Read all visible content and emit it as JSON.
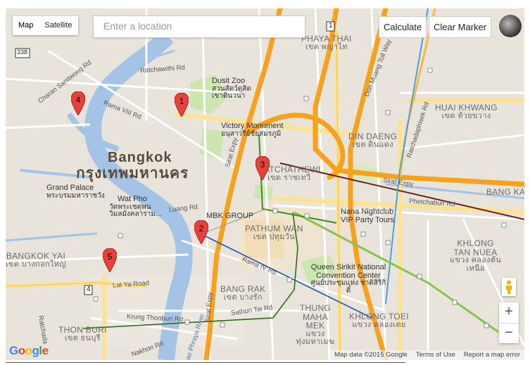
{
  "map_type": {
    "map_label": "Map",
    "satellite_label": "Satellite"
  },
  "search": {
    "placeholder": "Enter a location"
  },
  "buttons": {
    "calculate": "Calculate",
    "clear_marker": "Clear Marker"
  },
  "zoom": {
    "in": "+",
    "out": "−"
  },
  "attribution": {
    "data": "Map data ©2015 Google",
    "terms": "Terms of Use",
    "report": "Report a map error"
  },
  "logo": "Google",
  "city": {
    "en": "Bangkok",
    "th": "กรุงเทพมหานคร"
  },
  "districts": [
    {
      "en": "PHAYA THAI",
      "th": "เขต พญาไท"
    },
    {
      "en": "HUAI KHWANG",
      "th": "เขต ห้วยขวาง"
    },
    {
      "en": "DIN DAENG",
      "th": "เขต ดินแดง"
    },
    {
      "en": "RATCHATHEWI",
      "th": "เขต ราชเทวี"
    },
    {
      "en": "BANG KAPI",
      "th": ""
    },
    {
      "en": "PATHUM WAN",
      "th": "เขต ปทุมวัน"
    },
    {
      "en": "KHLONG TAN NUEA",
      "th": "แขวง คลองตัน เหนือ"
    },
    {
      "en": "BANGKOK YAI",
      "th": "เขต บางกอกใหญ่"
    },
    {
      "en": "BANG RAK",
      "th": "เขต บางรัก"
    },
    {
      "en": "THUNG MAHA MEK",
      "th": "แขวง ทุ่งมหาเมฆ"
    },
    {
      "en": "KHLONG TOEI",
      "th": "แขวง คลองเตย"
    },
    {
      "en": "THON BURI",
      "th": "เขต ธนบุรี"
    }
  ],
  "pois": {
    "dusit_zoo": {
      "en": "Dusit Zoo",
      "th": "สวนสัตว์ดุสิต เขาดินวนา"
    },
    "victory_monument": {
      "en": "Victory Monument",
      "th": "อนุสาวรีย์ชัยสมรภูมิ"
    },
    "grand_palace": {
      "en": "Grand Palace",
      "th": "พระบรมมหาราชวัง"
    },
    "wat_pho": {
      "en": "Wat Pho",
      "th": "วัดพระเชตุพน วิมลมังคลาราม..."
    },
    "mbk": {
      "en": "MBK GROUP"
    },
    "nana": {
      "en": "Nana Nightclub",
      "en2": "VIP Party Tours"
    },
    "qsncc": {
      "en": "Queen Sirikit National Convention Center",
      "th": "ศูนย์ประชุมแห่ง ชาติสิริกิติ์"
    }
  },
  "roads": {
    "ratchawithi": "Ratchawithi Rd",
    "rama8": "Rama VIII Rd",
    "charan": "Charan Sanitwong Rd",
    "luang": "Luang Rd",
    "rama4": "Rama IV Rd",
    "lat_ya": "Lat Ya Road",
    "krung_thonburi": "Krung Thonburi Rd",
    "sathon": "Sathon Tai Rd",
    "sirat1": "Sirat Expy",
    "sirat2": "Sirat Expy",
    "sirat3": "Sirat Expy",
    "phetchaburi": "Phetchaburi Rd",
    "don_muang": "Don Muang Toll Way",
    "ratchadaphisek": "Ratchadaphisek Rd",
    "chao_phraya": "Chao Phraya River",
    "nakhon": "Nakhon Rd",
    "ratchada": "Ratchada"
  },
  "shields": {
    "s338": "338",
    "s1": "1",
    "s4": "4"
  },
  "markers": [
    "1",
    "2",
    "3",
    "4",
    "5"
  ],
  "colors": {
    "water": "#a4c3e6",
    "park": "#cde6b1",
    "highway": "#f7a11d",
    "major": "#fde293",
    "marker": "#e8403a",
    "route_blue": "#1e55a8",
    "route_green": "#3a8f1c"
  }
}
